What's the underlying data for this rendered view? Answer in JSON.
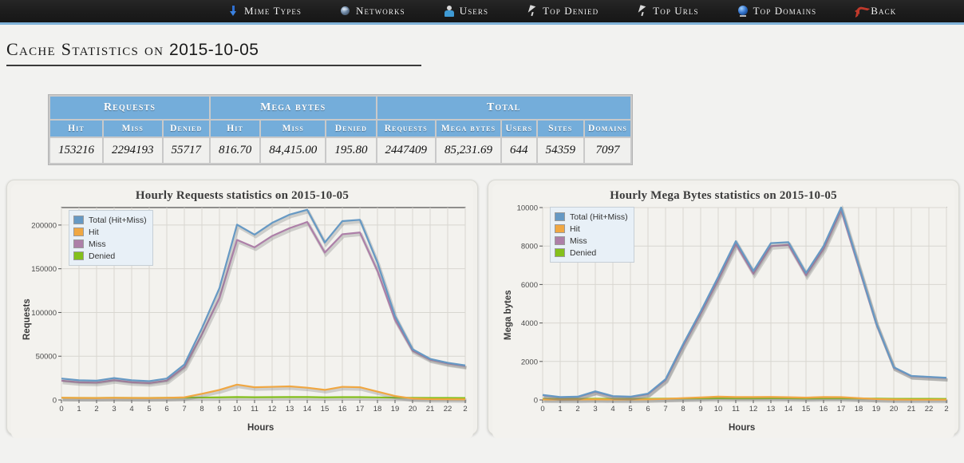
{
  "navbar": {
    "items": [
      {
        "label": "Mime Types",
        "icon": "mime-types-icon"
      },
      {
        "label": "Networks",
        "icon": "networks-globe-icon"
      },
      {
        "label": "Users",
        "icon": "users-person-icon"
      },
      {
        "label": "Top Denied",
        "icon": "cursor-arrow-icon"
      },
      {
        "label": "Top Urls",
        "icon": "cursor-arrow-icon"
      },
      {
        "label": "Top Domains",
        "icon": "globe-icon"
      },
      {
        "label": "Back",
        "icon": "back-undo-arrow-icon"
      }
    ]
  },
  "page": {
    "title_prefix": "Cache Statistics on ",
    "date": "2015-10-05"
  },
  "stats_table": {
    "group_headers": [
      {
        "label": "Requests",
        "span": 3
      },
      {
        "label": "Mega bytes",
        "span": 3
      },
      {
        "label": "Total",
        "span": 5
      }
    ],
    "sub_headers": [
      "Hit",
      "Miss",
      "Denied",
      "Hit",
      "Miss",
      "Denied",
      "Requests",
      "Mega bytes",
      "Users",
      "Sites",
      "Domains"
    ],
    "values": [
      "153216",
      "2294193",
      "55717",
      "816.70",
      "84,415.00",
      "195.80",
      "2447409",
      "85,231.69",
      "644",
      "54359",
      "7097"
    ]
  },
  "colors": {
    "total": "#6699c4",
    "hit": "#f0a742",
    "miss": "#ad7fa8",
    "denied": "#84c01c",
    "header_blue": "#74adda",
    "navbar_bg": "#1f1f1f",
    "navbar_accent": "#7fb2d8",
    "panel_bg": "#f1f0ec",
    "plot_bg": "#f3f2ee",
    "grid": "#d8d6d0"
  },
  "chart_data": [
    {
      "id": "hourly-requests",
      "type": "line",
      "title": "Hourly Requests statistics on 2015-10-05",
      "xlabel": "Hours",
      "ylabel": "Requests",
      "x": [
        0,
        1,
        2,
        3,
        4,
        5,
        6,
        7,
        8,
        9,
        10,
        11,
        12,
        13,
        14,
        15,
        16,
        17,
        18,
        19,
        20,
        21,
        22,
        23
      ],
      "xticklabels": [
        "0",
        "1",
        "2",
        "3",
        "4",
        "5",
        "6",
        "7",
        "8",
        "9",
        "10",
        "11",
        "12",
        "13",
        "14",
        "15",
        "16",
        "17",
        "18",
        "19",
        "20",
        "21",
        "22",
        "2"
      ],
      "xlim": [
        0,
        23
      ],
      "ylim": [
        0,
        220000
      ],
      "yticks": [
        0,
        50000,
        100000,
        150000,
        200000
      ],
      "yticklabels": [
        "0",
        "50000",
        "100000",
        "150000",
        "200000"
      ],
      "grid": true,
      "legend_position": "upper-left",
      "series": [
        {
          "name": "Total (Hit+Miss)",
          "color": "#6699c4",
          "values": [
            24500,
            22500,
            22000,
            25000,
            22500,
            21500,
            24500,
            40500,
            82000,
            128000,
            200500,
            189000,
            202500,
            212000,
            217500,
            180000,
            204500,
            206000,
            157000,
            96000,
            58000,
            47000,
            42500,
            39500
          ]
        },
        {
          "name": "Hit",
          "color": "#f0a742",
          "values": [
            2500,
            2300,
            2200,
            2400,
            2300,
            2200,
            2400,
            3000,
            7000,
            11500,
            17500,
            14500,
            15000,
            15500,
            14000,
            11500,
            15000,
            14500,
            9500,
            4500,
            1600,
            900,
            800,
            700
          ]
        },
        {
          "name": "Miss",
          "color": "#ad7fa8",
          "values": [
            22000,
            20200,
            19800,
            22600,
            20200,
            19300,
            22100,
            37500,
            75000,
            116500,
            183000,
            174500,
            187500,
            196500,
            203500,
            168500,
            189500,
            191500,
            147500,
            91500,
            56400,
            46100,
            41700,
            38800
          ]
        },
        {
          "name": "Denied",
          "color": "#84c01c",
          "values": [
            2400,
            2300,
            2300,
            2400,
            2300,
            2300,
            2400,
            2600,
            2800,
            3000,
            3300,
            3100,
            3200,
            3300,
            3300,
            3000,
            3200,
            3200,
            2900,
            2600,
            2400,
            2300,
            2300,
            2200
          ]
        }
      ]
    },
    {
      "id": "hourly-mega-bytes",
      "type": "line",
      "title": "Hourly Mega Bytes statistics on 2015-10-05",
      "xlabel": "Hours",
      "ylabel": "Mega bytes",
      "x": [
        0,
        1,
        2,
        3,
        4,
        5,
        6,
        7,
        8,
        9,
        10,
        11,
        12,
        13,
        14,
        15,
        16,
        17,
        18,
        19,
        20,
        21,
        22,
        23
      ],
      "xticklabels": [
        "0",
        "1",
        "2",
        "3",
        "4",
        "5",
        "6",
        "7",
        "8",
        "9",
        "10",
        "11",
        "12",
        "13",
        "14",
        "15",
        "16",
        "17",
        "18",
        "19",
        "20",
        "21",
        "22",
        "2"
      ],
      "xlim": [
        0,
        23
      ],
      "ylim": [
        0,
        10000
      ],
      "yticks": [
        0,
        2000,
        4000,
        6000,
        8000,
        10000
      ],
      "yticklabels": [
        "0",
        "2000",
        "4000",
        "6000",
        "8000",
        "10000"
      ],
      "grid": true,
      "legend_position": "upper-left",
      "series": [
        {
          "name": "Total (Hit+Miss)",
          "color": "#6699c4",
          "values": [
            260,
            150,
            170,
            450,
            200,
            170,
            330,
            1080,
            2900,
            4600,
            6400,
            8250,
            6700,
            8150,
            8200,
            6600,
            8000,
            10000,
            7000,
            4000,
            1700,
            1250,
            1200,
            1150
          ]
        },
        {
          "name": "Hit",
          "color": "#f0a742",
          "values": [
            25,
            18,
            18,
            30,
            20,
            18,
            28,
            55,
            95,
            130,
            170,
            150,
            150,
            155,
            140,
            120,
            150,
            145,
            95,
            45,
            20,
            14,
            13,
            12
          ]
        },
        {
          "name": "Miss",
          "color": "#ad7fa8",
          "values": [
            240,
            135,
            155,
            425,
            185,
            155,
            305,
            1030,
            2810,
            4480,
            6240,
            8100,
            6560,
            7995,
            8060,
            6480,
            7850,
            9860,
            6910,
            3955,
            1680,
            1236,
            1187,
            1138
          ]
        },
        {
          "name": "Denied",
          "color": "#84c01c",
          "values": [
            60,
            55,
            55,
            65,
            55,
            55,
            60,
            70,
            75,
            80,
            85,
            80,
            80,
            85,
            85,
            78,
            82,
            82,
            75,
            68,
            60,
            58,
            56,
            55
          ]
        }
      ]
    }
  ]
}
